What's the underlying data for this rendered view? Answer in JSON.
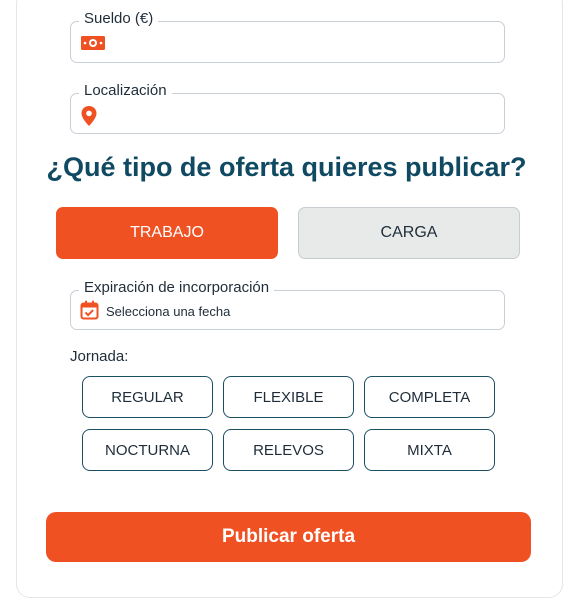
{
  "form": {
    "salary": {
      "label": "Sueldo (€)",
      "icon": "money-icon"
    },
    "location": {
      "label": "Localización",
      "icon": "location-pin-icon"
    },
    "offer_type": {
      "question": "¿Qué tipo de oferta quieres publicar?",
      "options": [
        {
          "label": "TRABAJO",
          "selected": true
        },
        {
          "label": "CARGA",
          "selected": false
        }
      ]
    },
    "expiration": {
      "label": "Expiración de incorporación",
      "placeholder": "Selecciona una fecha",
      "icon": "calendar-icon"
    },
    "jornada": {
      "label": "Jornada:",
      "options": [
        "REGULAR",
        "FLEXIBLE",
        "COMPLETA",
        "NOCTURNA",
        "RELEVOS",
        "MIXTA"
      ]
    },
    "submit_label": "Publicar oferta"
  },
  "colors": {
    "accent": "#f05123",
    "heading": "#0f4a62",
    "chip_border": "#1d4f63",
    "inactive_bg": "#e8eaea"
  }
}
